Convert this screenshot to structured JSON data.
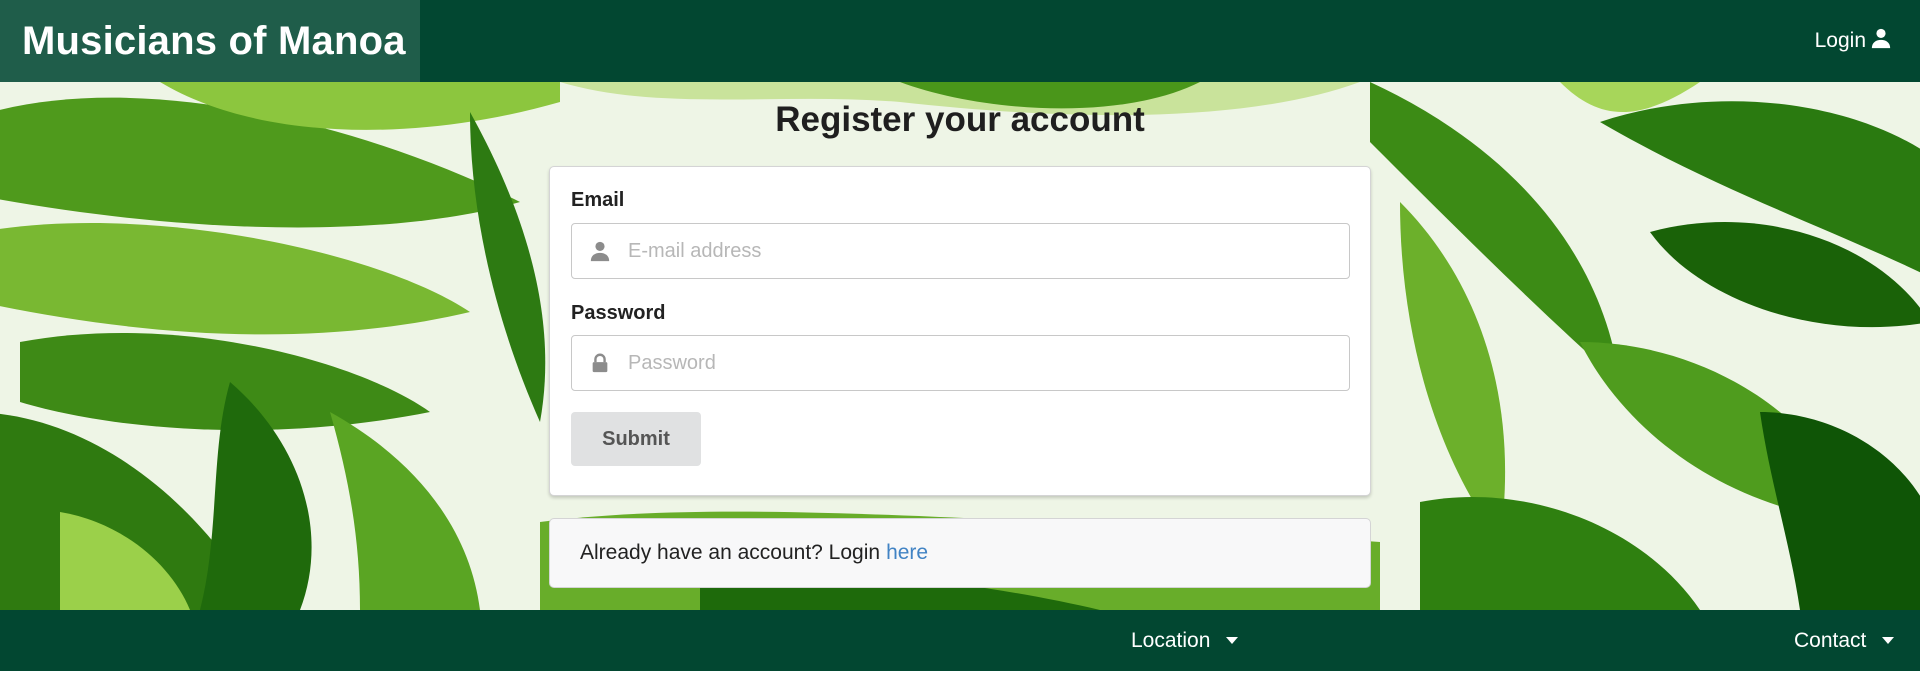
{
  "navbar": {
    "brand": "Musicians of Manoa",
    "login_label": "Login",
    "login_icon": "user-icon"
  },
  "page": {
    "title": "Register your account"
  },
  "form": {
    "email_label": "Email",
    "email_placeholder": "E-mail address",
    "email_value": "",
    "email_icon": "user-icon",
    "password_label": "Password",
    "password_placeholder": "Password",
    "password_value": "",
    "password_icon": "lock-icon",
    "submit_label": "Submit"
  },
  "message": {
    "text": "Already have an account? Login",
    "link_text": "here"
  },
  "footer": {
    "location_label": "Location",
    "contact_label": "Contact"
  },
  "colors": {
    "nav_bg": "#024731",
    "brand_bg": "#1f5d4a",
    "link": "#4183c4",
    "button_bg": "#e0e1e2"
  }
}
